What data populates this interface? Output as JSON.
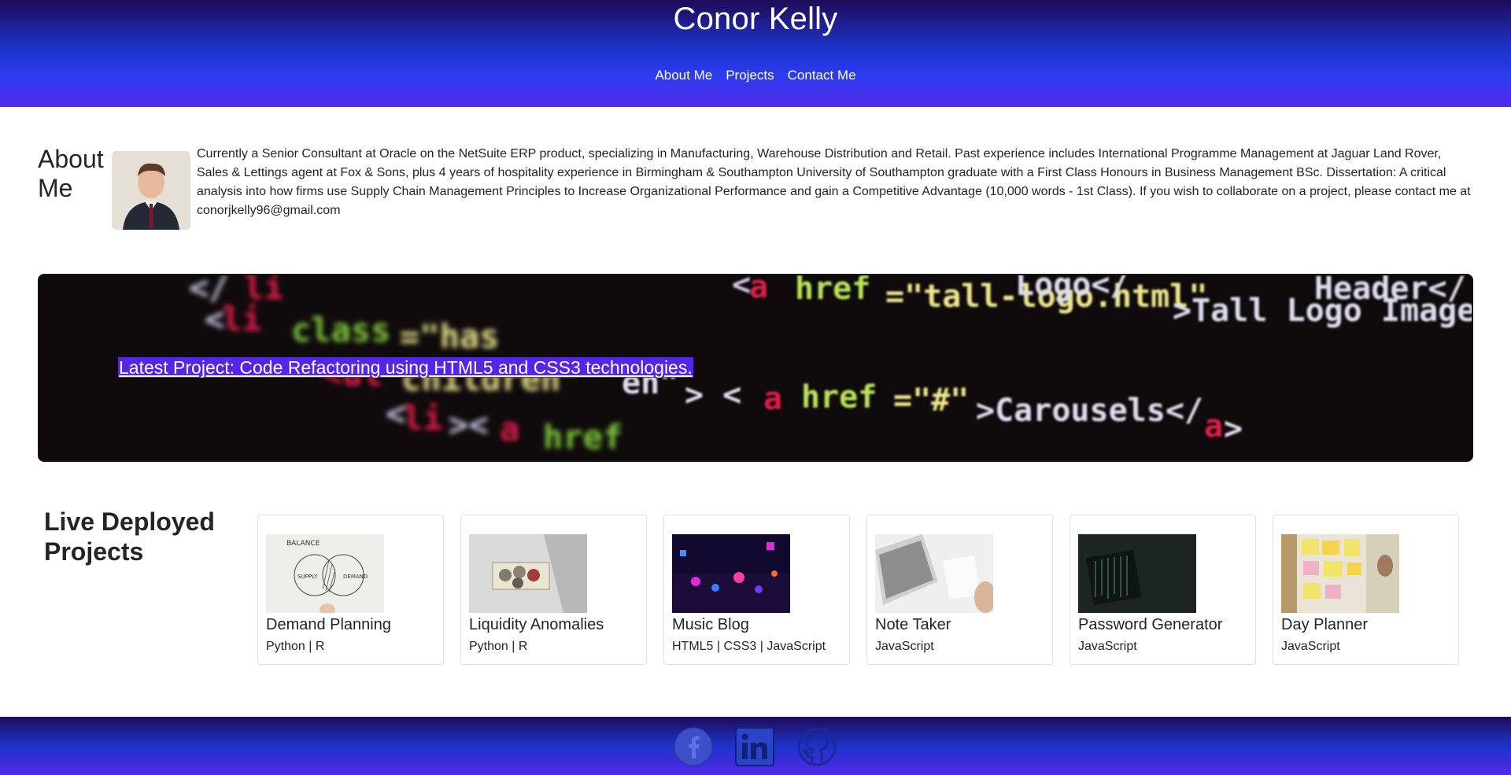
{
  "header": {
    "title": "Conor Kelly",
    "nav": [
      "About Me",
      "Projects",
      "Contact Me"
    ]
  },
  "about": {
    "heading": "About Me",
    "photo_icon": "profile-photo",
    "text": "Currently a Senior Consultant at Oracle on the NetSuite ERP product, specializing in Manufacturing, Warehouse Distribution and Retail. Past experience includes International Programme Management at Jaguar Land Rover, Sales & Lettings agent at Fox & Sons, plus 4 years of hospitality experience in Birmingham & Southampton University of Southampton graduate with a First Class Honours in Business Management BSc. Dissertation: A critical analysis into how firms use Supply Chain Management Principles to Increase Organizational Performance and gain a Competitive Advantage (10,000 words - 1st Class). If you wish to collaborate on a project, please contact me at conorjkelly96@gmail.com"
  },
  "banner": {
    "link_text": "Latest Project: Code Refactoring using HTML5 and CSS3 technologies.",
    "code_lines": [
      "<li><a href=\"tall-logo.html\">Tall Logo Image</a></li>",
      "<li class=\"has-children\"> <a href=\"#\">Carousels</a>",
      "<li><a href=\"#\">"
    ]
  },
  "projects": {
    "heading": "Live Deployed Projects",
    "items": [
      {
        "title": "Demand Planning",
        "tech": "Python | R",
        "thumb_labels": [
          "BALANCE",
          "SUPPLY",
          "DEMAND"
        ]
      },
      {
        "title": "Liquidity Anomalies",
        "tech": "Python | R"
      },
      {
        "title": "Music Blog",
        "tech": "HTML5 | CSS3 | JavaScript"
      },
      {
        "title": "Note Taker",
        "tech": "JavaScript"
      },
      {
        "title": "Password Generator",
        "tech": "JavaScript"
      },
      {
        "title": "Day Planner",
        "tech": "JavaScript"
      }
    ]
  },
  "footer": {
    "icons": [
      "facebook-icon",
      "linkedin-icon",
      "github-icon"
    ]
  },
  "colors": {
    "header_dark": "#1f0b5a",
    "header_blue": "#1c33c9",
    "accent": "#5129ea"
  }
}
